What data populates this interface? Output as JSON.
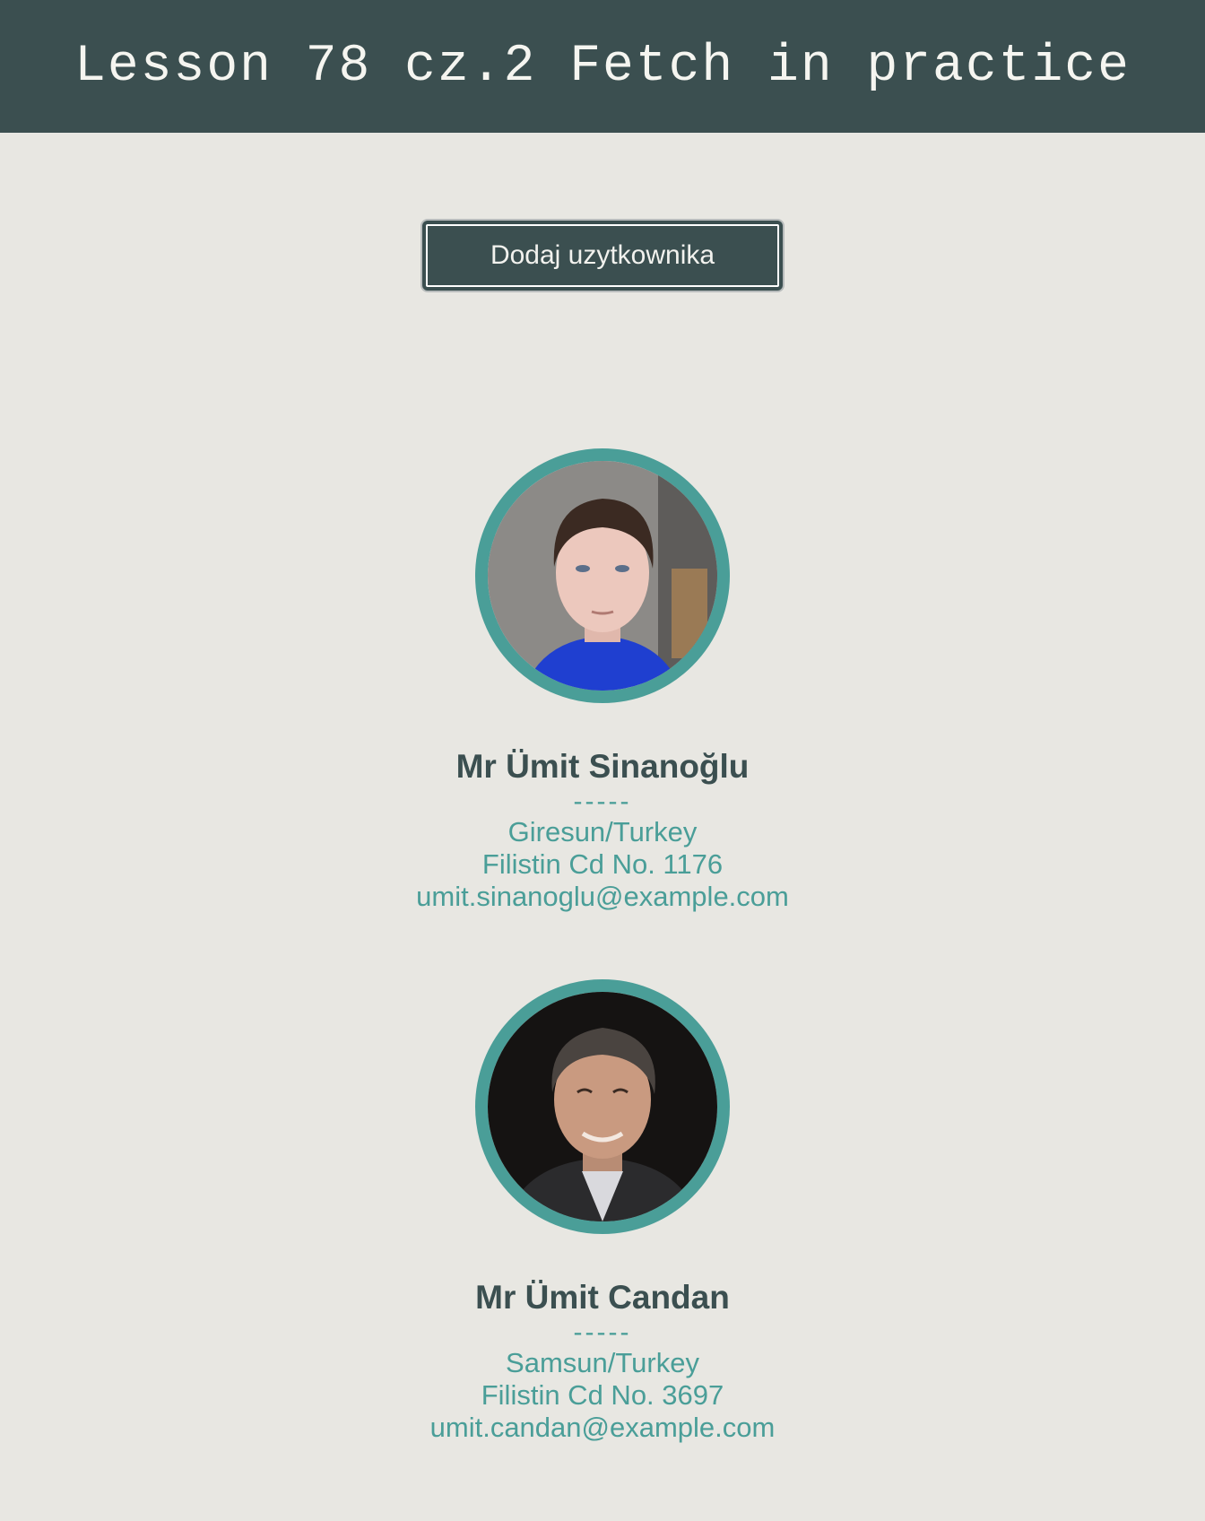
{
  "header": {
    "title": "Lesson 78 cz.2 Fetch in practice"
  },
  "toolbar": {
    "add_user_label": "Dodaj uzytkownika"
  },
  "users": [
    {
      "name": "Mr Ümit Sinanoğlu",
      "divider": "-----",
      "location": "Giresun/Turkey",
      "street": "Filistin Cd No. 1176",
      "email": "umit.sinanoglu@example.com"
    },
    {
      "name": "Mr Ümit Candan",
      "divider": "-----",
      "location": "Samsun/Turkey",
      "street": "Filistin Cd No. 3697",
      "email": "umit.candan@example.com"
    }
  ],
  "colors": {
    "header_bg": "#3b4f50",
    "page_bg": "#e8e7e2",
    "accent": "#4a9e98",
    "name_text": "#3b4f50"
  }
}
